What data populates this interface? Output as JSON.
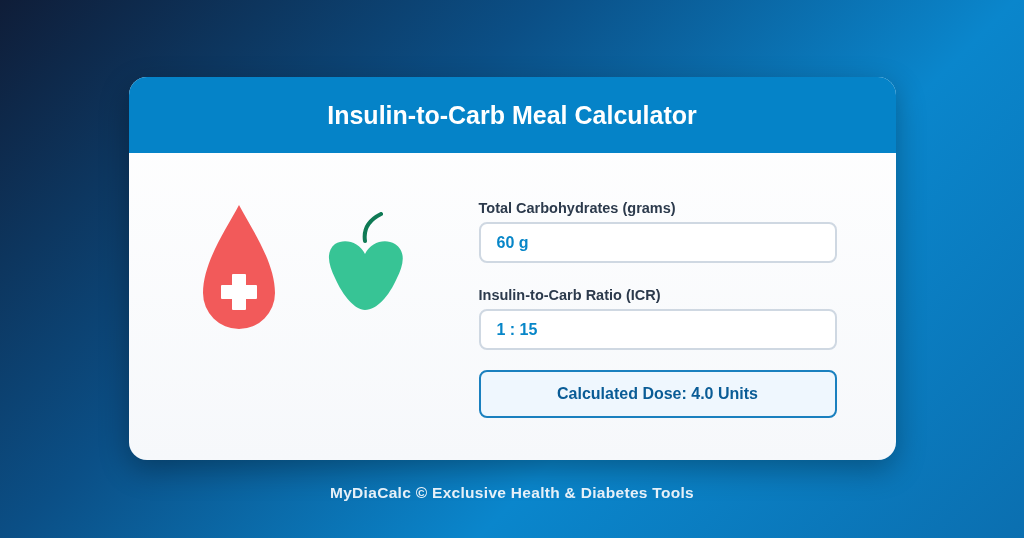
{
  "card": {
    "title": "Insulin-to-Carb Meal Calculator"
  },
  "fields": [
    {
      "label": "Total Carbohydrates (grams)",
      "value": "60 g"
    },
    {
      "label": "Insulin-to-Carb Ratio (ICR)",
      "value": "1 : 15"
    }
  ],
  "result": "Calculated Dose: 4.0 Units",
  "footer": "MyDiaCalc © Exclusive Health & Diabetes Tools"
}
